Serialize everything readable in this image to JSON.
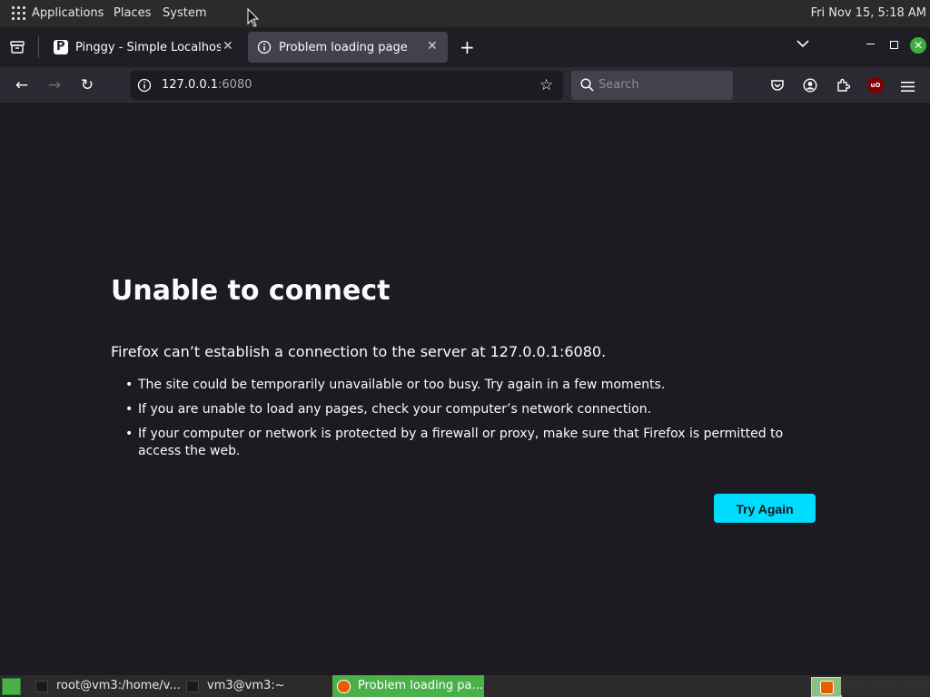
{
  "topbar": {
    "menus": [
      "Applications",
      "Places",
      "System"
    ],
    "clock": "Fri Nov 15,  5:18 AM"
  },
  "tabs": [
    {
      "title": "Pinggy - Simple Localhost T",
      "favicon": "P",
      "active": false
    },
    {
      "title": "Problem loading page",
      "favicon": "info-icon",
      "active": true
    }
  ],
  "navbar": {
    "url_host": "127.0.0.1",
    "url_port": ":6080",
    "search_placeholder": "Search"
  },
  "error": {
    "title": "Unable to connect",
    "description": "Firefox can’t establish a connection to the server at 127.0.0.1:6080.",
    "bullets": [
      "The site could be temporarily unavailable or too busy. Try again in a few moments.",
      "If you are unable to load any pages, check your computer’s network connection.",
      "If your computer or network is protected by a firewall or proxy, make sure that Firefox is permitted to access the web."
    ],
    "button": "Try Again"
  },
  "taskbar": {
    "items": [
      "root@vm3:/home/v...",
      "vm3@vm3:~",
      "Problem loading pa..."
    ]
  },
  "colors": {
    "accent": "#00ddff",
    "page_bg": "#1c1b22",
    "taskbar_active": "#4ab04a"
  }
}
